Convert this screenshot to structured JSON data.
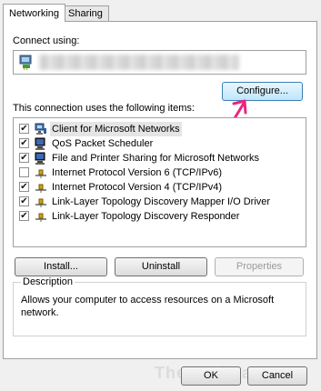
{
  "tabs": [
    {
      "label": "Networking",
      "active": true
    },
    {
      "label": "Sharing",
      "active": false
    }
  ],
  "connect": {
    "label": "Connect using:",
    "adapter_icon": "network-adapter-icon",
    "adapter_name_redacted": true
  },
  "configure_label": "Configure...",
  "items_label": "This connection uses the following items:",
  "items": [
    {
      "label": "Client for Microsoft Networks",
      "checked": true,
      "icon": "network-client-icon",
      "highlighted": true
    },
    {
      "label": "QoS Packet Scheduler",
      "checked": true,
      "icon": "computer-service-icon"
    },
    {
      "label": "File and Printer Sharing for Microsoft Networks",
      "checked": true,
      "icon": "computer-service-icon"
    },
    {
      "label": "Internet Protocol Version 6 (TCP/IPv6)",
      "checked": false,
      "icon": "protocol-icon"
    },
    {
      "label": "Internet Protocol Version 4 (TCP/IPv4)",
      "checked": true,
      "icon": "protocol-icon"
    },
    {
      "label": "Link-Layer Topology Discovery Mapper I/O Driver",
      "checked": true,
      "icon": "protocol-icon"
    },
    {
      "label": "Link-Layer Topology Discovery Responder",
      "checked": true,
      "icon": "protocol-icon"
    }
  ],
  "buttons": {
    "install": "Install...",
    "uninstall": "Uninstall",
    "properties": "Properties"
  },
  "description": {
    "title": "Description",
    "text": "Allows your computer to access resources on a Microsoft network."
  },
  "footer": {
    "ok": "OK",
    "cancel": "Cancel",
    "watermark": "TheGeekPage"
  },
  "colors": {
    "annotation_arrow": "#e8267f",
    "focus_border": "#3c7fb1"
  }
}
